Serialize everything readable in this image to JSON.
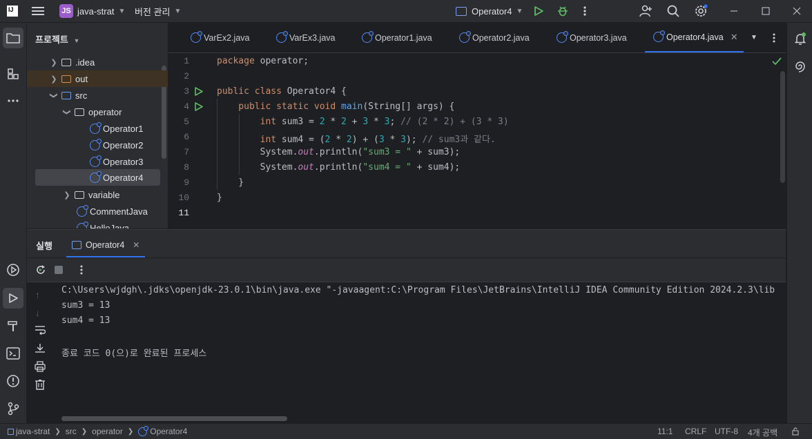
{
  "titlebar": {
    "app_logo": "IJ",
    "project_badge": "JS",
    "project_name": "java-strat",
    "vcs_menu": "버전 관리",
    "run_config": "Operator4"
  },
  "project_panel": {
    "title": "프로젝트",
    "items": [
      {
        "label": ".idea"
      },
      {
        "label": "out"
      },
      {
        "label": "src"
      },
      {
        "label": "operator"
      },
      {
        "label": "Operator1"
      },
      {
        "label": "Operator2"
      },
      {
        "label": "Operator3"
      },
      {
        "label": "Operator4"
      },
      {
        "label": "variable"
      },
      {
        "label": "CommentJava"
      },
      {
        "label": "HelloJava"
      }
    ]
  },
  "tabs": [
    {
      "label": "VarEx2.java"
    },
    {
      "label": "VarEx3.java"
    },
    {
      "label": "Operator1.java"
    },
    {
      "label": "Operator2.java"
    },
    {
      "label": "Operator3.java"
    },
    {
      "label": "Operator4.java"
    }
  ],
  "editor": {
    "line_numbers": [
      "1",
      "2",
      "3",
      "4",
      "5",
      "6",
      "7",
      "8",
      "9",
      "10",
      "11"
    ],
    "lines": [
      [
        {
          "t": "package ",
          "c": "kw"
        },
        {
          "t": "operator;",
          "c": ""
        }
      ],
      [],
      [
        {
          "t": "public class ",
          "c": "kw"
        },
        {
          "t": "Operator4 {",
          "c": ""
        }
      ],
      [
        {
          "t": "    public static void ",
          "c": "kw"
        },
        {
          "t": "main",
          "c": "fn"
        },
        {
          "t": "(String[] args) {",
          "c": ""
        }
      ],
      [
        {
          "t": "        int ",
          "c": "kw"
        },
        {
          "t": "sum3 = ",
          "c": ""
        },
        {
          "t": "2",
          "c": "num"
        },
        {
          "t": " * ",
          "c": ""
        },
        {
          "t": "2",
          "c": "num"
        },
        {
          "t": " + ",
          "c": ""
        },
        {
          "t": "3",
          "c": "num"
        },
        {
          "t": " * ",
          "c": ""
        },
        {
          "t": "3",
          "c": "num"
        },
        {
          "t": "; ",
          "c": ""
        },
        {
          "t": "// (2 * 2) + (3 * 3)",
          "c": "cmt"
        }
      ],
      [
        {
          "t": "        int ",
          "c": "kw"
        },
        {
          "t": "sum4 = (",
          "c": ""
        },
        {
          "t": "2",
          "c": "num"
        },
        {
          "t": " * ",
          "c": ""
        },
        {
          "t": "2",
          "c": "num"
        },
        {
          "t": ") + (",
          "c": ""
        },
        {
          "t": "3",
          "c": "num"
        },
        {
          "t": " * ",
          "c": ""
        },
        {
          "t": "3",
          "c": "num"
        },
        {
          "t": "); ",
          "c": ""
        },
        {
          "t": "// sum3과 같다.",
          "c": "cmt"
        }
      ],
      [
        {
          "t": "        System.",
          "c": ""
        },
        {
          "t": "out",
          "c": "fld"
        },
        {
          "t": ".println(",
          "c": ""
        },
        {
          "t": "\"sum3 = \"",
          "c": "str"
        },
        {
          "t": " + sum3);",
          "c": ""
        }
      ],
      [
        {
          "t": "        System.",
          "c": ""
        },
        {
          "t": "out",
          "c": "fld"
        },
        {
          "t": ".println(",
          "c": ""
        },
        {
          "t": "\"sum4 = \"",
          "c": "str"
        },
        {
          "t": " + sum4);",
          "c": ""
        }
      ],
      [
        {
          "t": "    }",
          "c": ""
        }
      ],
      [
        {
          "t": "}",
          "c": ""
        }
      ],
      []
    ]
  },
  "run_panel": {
    "title": "실행",
    "tab_label": "Operator4",
    "output": [
      "C:\\Users\\wjdgh\\.jdks\\openjdk-23.0.1\\bin\\java.exe \"-javaagent:C:\\Program Files\\JetBrains\\IntelliJ IDEA Community Edition 2024.2.3\\lib",
      "sum3 = 13",
      "sum4 = 13",
      "",
      "종료 코드 0(으)로 완료된 프로세스"
    ]
  },
  "statusbar": {
    "crumbs": [
      "java-strat",
      "src",
      "operator",
      "Operator4"
    ],
    "position": "11:1",
    "line_sep": "CRLF",
    "encoding": "UTF-8",
    "indent": "4개 공백"
  },
  "colors": {
    "accent": "#3574f0",
    "keyword": "#cf8e6d",
    "number": "#2aacb8",
    "string": "#6aab73",
    "run_green": "#5fb865"
  }
}
